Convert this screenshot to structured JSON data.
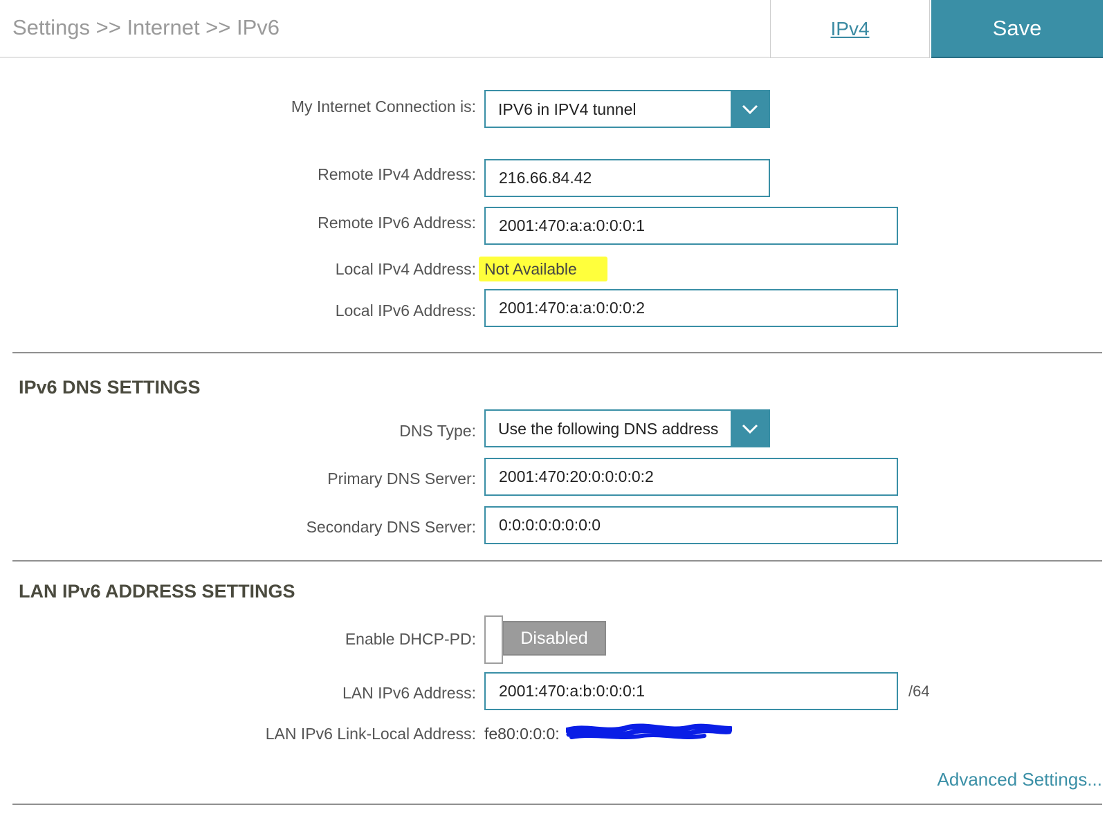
{
  "header": {
    "breadcrumb": "Settings >> Internet >> IPv6",
    "ipv4_tab": "IPv4",
    "save_label": "Save"
  },
  "connection": {
    "type_label": "My Internet Connection is:",
    "type_value": "IPV6 in IPV4 tunnel",
    "remote_ipv4_label": "Remote IPv4 Address:",
    "remote_ipv4_value": "216.66.84.42",
    "remote_ipv6_label": "Remote IPv6 Address:",
    "remote_ipv6_value": "2001:470:a:a:0:0:0:1",
    "local_ipv4_label": "Local IPv4 Address:",
    "local_ipv4_value": "Not Available",
    "local_ipv6_label": "Local IPv6 Address:",
    "local_ipv6_value": "2001:470:a:a:0:0:0:2"
  },
  "dns": {
    "section_title": "IPv6 DNS SETTINGS",
    "type_label": "DNS Type:",
    "type_value": "Use the following DNS address",
    "primary_label": "Primary DNS Server:",
    "primary_value": "2001:470:20:0:0:0:0:2",
    "secondary_label": "Secondary DNS Server:",
    "secondary_value": "0:0:0:0:0:0:0:0"
  },
  "lan": {
    "section_title": "LAN IPv6 ADDRESS SETTINGS",
    "dhcp_pd_label": "Enable DHCP-PD:",
    "dhcp_pd_state": "Disabled",
    "address_label": "LAN IPv6 Address:",
    "address_value": "2001:470:a:b:0:0:0:1",
    "prefix_suffix": "/64",
    "link_local_label": "LAN IPv6 Link-Local Address:",
    "link_local_value": "fe80:0:0:0:",
    "advanced_link": "Advanced Settings..."
  },
  "colors": {
    "accent": "#3a8fa6",
    "highlight": "#ffff3c",
    "redaction": "#0a1ee6",
    "toggle_off": "#9b9b9b"
  }
}
